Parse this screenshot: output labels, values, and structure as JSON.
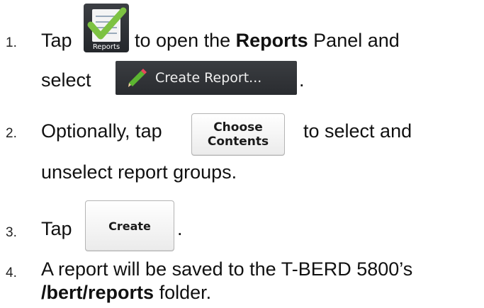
{
  "steps": [
    {
      "number": "1.",
      "text_a": "Tap",
      "text_b": "to open the",
      "text_bold": "Reports",
      "text_c": "Panel and",
      "text_d": "select",
      "text_e": "."
    },
    {
      "number": "2.",
      "text_a": "Optionally, tap",
      "text_b": "to select and",
      "text_c": "unselect report groups."
    },
    {
      "number": "3.",
      "text_a": "Tap",
      "text_b": "."
    },
    {
      "number": "4.",
      "text_a": "A report will be saved to the T-BERD 5800’s",
      "text_bold": "/bert/reports",
      "text_b": "folder."
    }
  ],
  "reports_icon": {
    "caption": "Reports",
    "icon": "checklist-icon"
  },
  "create_report_button": {
    "label": "Create Report...",
    "icon": "pencil-icon"
  },
  "choose_contents_button": {
    "label": "Choose\nContents"
  },
  "create_button": {
    "label": "Create"
  },
  "colors": {
    "check_green": "#7dc242",
    "dark_button": "#2e3135",
    "pencil_green": "#5cb531"
  }
}
